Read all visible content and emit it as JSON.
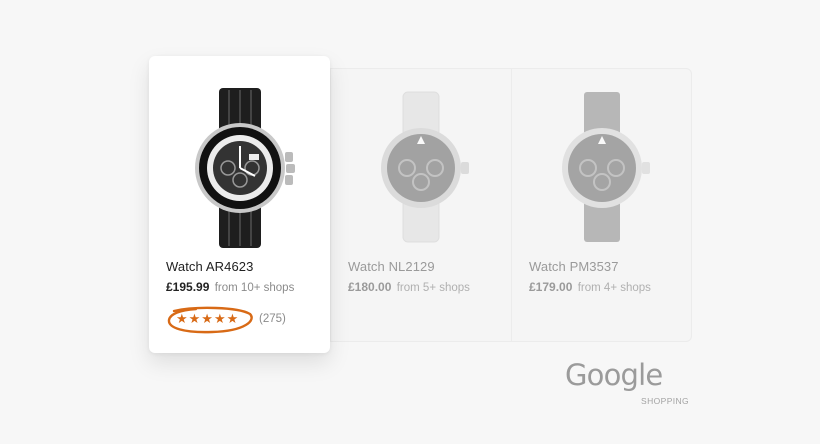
{
  "products": [
    {
      "title": "Watch AR4623",
      "price": "£195.99",
      "shops": "from 10+ shops",
      "stars": "★★★★★",
      "rating_value": 5,
      "reviews": "(275)",
      "state": "selected",
      "watch_icon": "black-chronograph-watch"
    },
    {
      "title": "Watch NL2129",
      "price": "£180.00",
      "shops": "from 5+ shops",
      "state": "faded",
      "watch_icon": "white-strap-pilot-watch"
    },
    {
      "title": "Watch PM3537",
      "price": "£179.00",
      "shops": "from 4+ shops",
      "state": "faded",
      "watch_icon": "grey-strap-pilot-watch"
    }
  ],
  "branding": {
    "logo": "Google",
    "subtitle": "SHOPPING"
  },
  "colors": {
    "highlight": "#d86a16",
    "background": "#f7f7f7",
    "card": "#ffffff"
  }
}
